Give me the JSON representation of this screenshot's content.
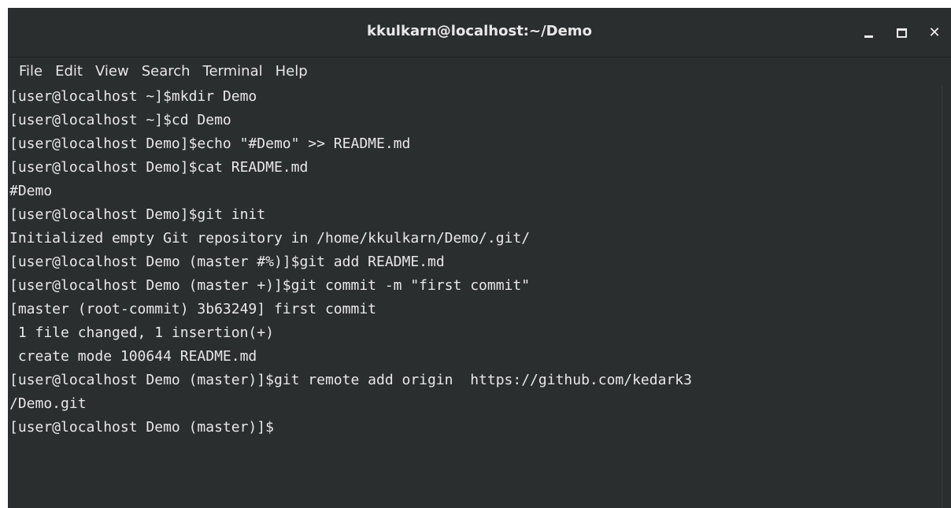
{
  "window": {
    "title": "kkulkarn@localhost:~/Demo",
    "controls": {
      "minimize": "minimize",
      "maximize": "maximize",
      "close": "close"
    }
  },
  "menu": [
    "File",
    "Edit",
    "View",
    "Search",
    "Terminal",
    "Help"
  ],
  "terminal": {
    "lines": [
      "[user@localhost ~]$mkdir Demo",
      "[user@localhost ~]$cd Demo",
      "[user@localhost Demo]$echo \"#Demo\" >> README.md",
      "[user@localhost Demo]$cat README.md",
      "#Demo",
      "[user@localhost Demo]$git init",
      "Initialized empty Git repository in /home/kkulkarn/Demo/.git/",
      "[user@localhost Demo (master #%)]$git add README.md",
      "[user@localhost Demo (master +)]$git commit -m \"first commit\"",
      "[master (root-commit) 3b63249] first commit",
      " 1 file changed, 1 insertion(+)",
      " create mode 100644 README.md",
      "[user@localhost Demo (master)]$git remote add origin  https://github.com/kedark3",
      "/Demo.git",
      "[user@localhost Demo (master)]$"
    ]
  },
  "colors": {
    "background": "#2b2e2f",
    "foreground": "#e8e8e8"
  }
}
